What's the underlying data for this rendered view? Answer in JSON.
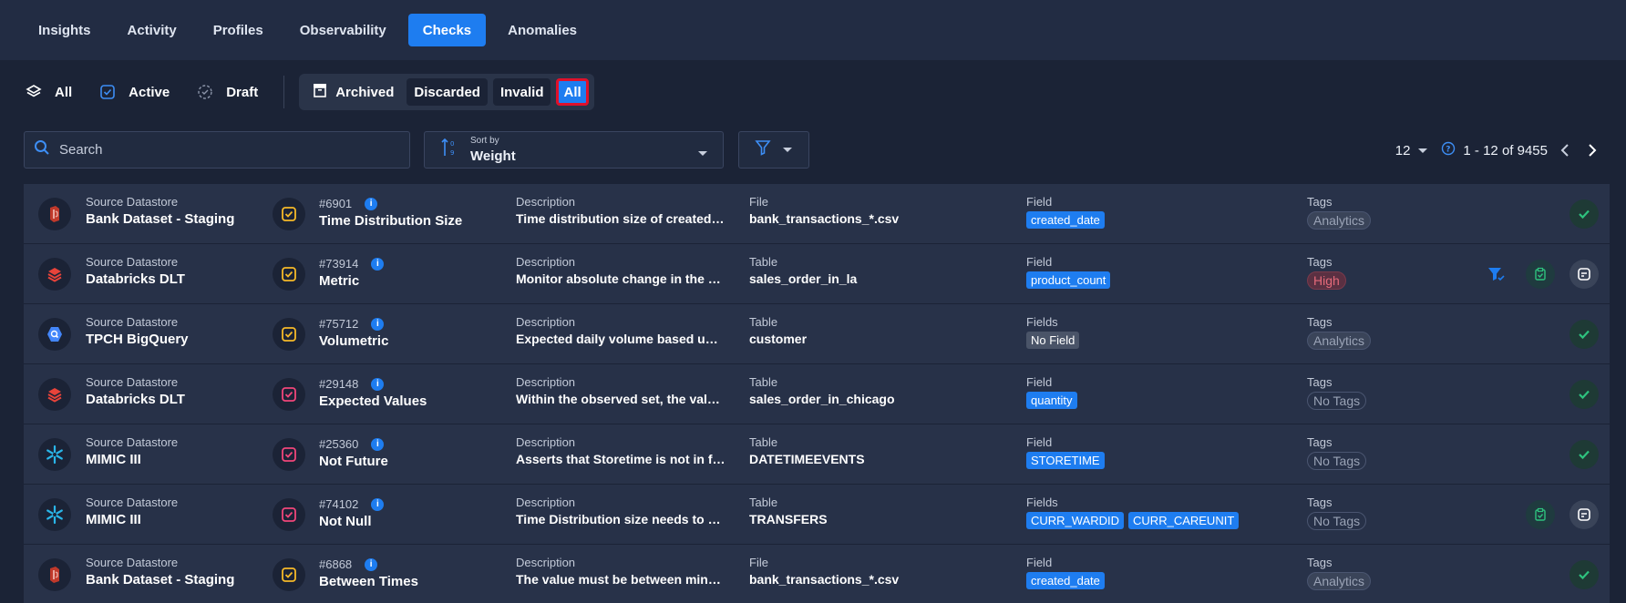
{
  "tabs": [
    {
      "label": "Insights",
      "active": false
    },
    {
      "label": "Activity",
      "active": false
    },
    {
      "label": "Profiles",
      "active": false
    },
    {
      "label": "Observability",
      "active": false
    },
    {
      "label": "Checks",
      "active": true
    },
    {
      "label": "Anomalies",
      "active": false
    }
  ],
  "status_filters": {
    "all": "All",
    "active": "Active",
    "draft": "Draft"
  },
  "archive_group": {
    "archived": "Archived",
    "discarded": "Discarded",
    "invalid": "Invalid",
    "all": "All"
  },
  "search": {
    "placeholder": "Search"
  },
  "sort": {
    "label": "Sort by",
    "value": "Weight"
  },
  "pager": {
    "per_page": "12",
    "range": "1 - 12 of 9455"
  },
  "colors": {
    "accent": "#1e7df0",
    "success": "#2ec27e",
    "highlight": "#e0102a"
  },
  "rows": [
    {
      "ds_label": "Source Datastore",
      "ds_name": "Bank Dataset - Staging",
      "ds_icon": "bank-icon",
      "check_id": "#6901",
      "check_name": "Time Distribution Size",
      "check_color": "yellow",
      "desc_label": "Description",
      "desc": "Time distribution size of created_...",
      "file_label": "File",
      "file": "bank_transactions_*.csv",
      "field_label": "Field",
      "fields": [
        "created_date"
      ],
      "tags_label": "Tags",
      "tag": "Analytics",
      "tag_kind": "normal",
      "actions": [
        "ok"
      ]
    },
    {
      "ds_label": "Source Datastore",
      "ds_name": "Databricks DLT",
      "ds_icon": "databricks-icon",
      "check_id": "#73914",
      "check_name": "Metric",
      "check_color": "yellow",
      "desc_label": "Description",
      "desc": "Monitor absolute change in the m...",
      "file_label": "Table",
      "file": "sales_order_in_la",
      "field_label": "Field",
      "fields": [
        "product_count"
      ],
      "tags_label": "Tags",
      "tag": "High",
      "tag_kind": "high",
      "actions": [
        "funnel",
        "clip",
        "note"
      ]
    },
    {
      "ds_label": "Source Datastore",
      "ds_name": "TPCH BigQuery",
      "ds_icon": "bigquery-icon",
      "check_id": "#75712",
      "check_name": "Volumetric",
      "check_color": "yellow",
      "desc_label": "Description",
      "desc": "Expected daily volume based upo...",
      "file_label": "Table",
      "file": "customer",
      "field_label": "Fields",
      "fields": [
        "No Field"
      ],
      "fields_gray": true,
      "tags_label": "Tags",
      "tag": "Analytics",
      "tag_kind": "normal",
      "actions": [
        "ok"
      ]
    },
    {
      "ds_label": "Source Datastore",
      "ds_name": "Databricks DLT",
      "ds_icon": "databricks-icon",
      "check_id": "#29148",
      "check_name": "Expected Values",
      "check_color": "pink",
      "desc_label": "Description",
      "desc": "Within the observed set, the valu...",
      "file_label": "Table",
      "file": "sales_order_in_chicago",
      "field_label": "Field",
      "fields": [
        "quantity"
      ],
      "tags_label": "Tags",
      "tag": "No Tags",
      "tag_kind": "none",
      "actions": [
        "ok"
      ]
    },
    {
      "ds_label": "Source Datastore",
      "ds_name": "MIMIC III",
      "ds_icon": "snowflake-icon",
      "check_id": "#25360",
      "check_name": "Not Future",
      "check_color": "pink",
      "desc_label": "Description",
      "desc": "Asserts that Storetime is not in fu...",
      "file_label": "Table",
      "file": "DATETIMEEVENTS",
      "field_label": "Field",
      "fields": [
        "STORETIME"
      ],
      "tags_label": "Tags",
      "tag": "No Tags",
      "tag_kind": "none",
      "actions": [
        "ok"
      ]
    },
    {
      "ds_label": "Source Datastore",
      "ds_name": "MIMIC III",
      "ds_icon": "snowflake-icon",
      "check_id": "#74102",
      "check_name": "Not Null",
      "check_color": "pink",
      "desc_label": "Description",
      "desc": "Time Distribution size needs to be...",
      "file_label": "Table",
      "file": "TRANSFERS",
      "field_label": "Fields",
      "fields": [
        "CURR_WARDID",
        "CURR_CAREUNIT"
      ],
      "tags_label": "Tags",
      "tag": "No Tags",
      "tag_kind": "none",
      "actions": [
        "clip",
        "note"
      ]
    },
    {
      "ds_label": "Source Datastore",
      "ds_name": "Bank Dataset - Staging",
      "ds_icon": "bank-icon",
      "check_id": "#6868",
      "check_name": "Between Times",
      "check_color": "yellow",
      "desc_label": "Description",
      "desc": "The value must be between minTi...",
      "file_label": "File",
      "file": "bank_transactions_*.csv",
      "field_label": "Field",
      "fields": [
        "created_date"
      ],
      "tags_label": "Tags",
      "tag": "Analytics",
      "tag_kind": "normal",
      "actions": [
        "ok"
      ]
    }
  ]
}
